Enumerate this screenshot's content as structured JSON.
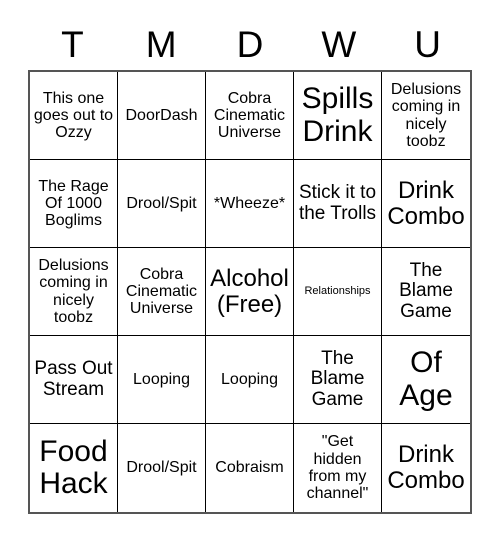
{
  "card": {
    "headers": [
      "T",
      "M",
      "D",
      "W",
      "U"
    ],
    "rows": [
      [
        {
          "text": "This one goes out to Ozzy",
          "size": "sm"
        },
        {
          "text": "DoorDash",
          "size": "sm"
        },
        {
          "text": "Cobra Cinematic Universe",
          "size": "sm"
        },
        {
          "text": "Spills Drink",
          "size": "xl"
        },
        {
          "text": "Delusions coming in nicely toobz",
          "size": "sm"
        }
      ],
      [
        {
          "text": "The Rage Of 1000 Boglims",
          "size": "sm"
        },
        {
          "text": "Drool/Spit",
          "size": "sm"
        },
        {
          "text": "*Wheeze*",
          "size": "sm"
        },
        {
          "text": "Stick it to the Trolls",
          "size": "md"
        },
        {
          "text": "Drink Combo",
          "size": "lg"
        }
      ],
      [
        {
          "text": "Delusions coming in nicely toobz",
          "size": "sm"
        },
        {
          "text": "Cobra Cinematic Universe",
          "size": "sm"
        },
        {
          "text": "Alcohol (Free)",
          "size": "lg"
        },
        {
          "text": "Relationships",
          "size": "xs"
        },
        {
          "text": "The Blame Game",
          "size": "md"
        }
      ],
      [
        {
          "text": "Pass Out Stream",
          "size": "md"
        },
        {
          "text": "Looping",
          "size": "sm"
        },
        {
          "text": "Looping",
          "size": "sm"
        },
        {
          "text": "The Blame Game",
          "size": "md"
        },
        {
          "text": "Of Age",
          "size": "xl"
        }
      ],
      [
        {
          "text": "Food Hack",
          "size": "xl"
        },
        {
          "text": "Drool/Spit",
          "size": "sm"
        },
        {
          "text": "Cobraism",
          "size": "sm"
        },
        {
          "text": "\"Get hidden from my channel\"",
          "size": "sm"
        },
        {
          "text": "Drink Combo",
          "size": "lg"
        }
      ]
    ]
  }
}
